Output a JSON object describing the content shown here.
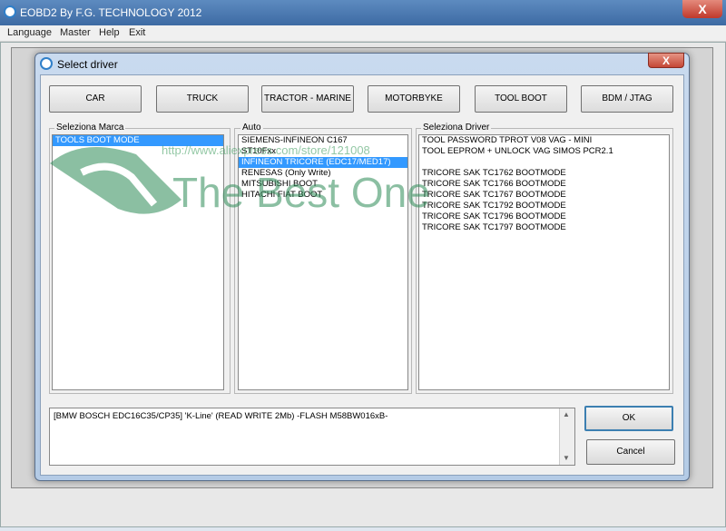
{
  "window": {
    "title": "EOBD2 By F.G. TECHNOLOGY 2012",
    "close_glyph": "X"
  },
  "menu": [
    "Language",
    "Master",
    "Help",
    "Exit"
  ],
  "dialog": {
    "title": "Select driver",
    "close_glyph": "X"
  },
  "categories": [
    "CAR",
    "TRUCK",
    "TRACTOR - MARINE",
    "MOTORBYKE",
    "TOOL BOOT",
    "BDM / JTAG"
  ],
  "marca": {
    "legend": "Seleziona Marca",
    "items": [
      "TOOLS BOOT MODE"
    ],
    "selected_index": 0
  },
  "auto": {
    "legend": "Auto",
    "items": [
      "SIEMENS-INFINEON C167",
      "ST10Fxx",
      "INFINEON TRICORE (EDC17/MED17)",
      "RENESAS (Only Write)",
      "MITSUBISHI BOOT",
      "HITACHI FIAT BOOT"
    ],
    "selected_index": 2
  },
  "driver": {
    "legend": "Seleziona Driver",
    "items": [
      "TOOL PASSWORD TPROT V08 VAG - MINI",
      "TOOL EEPROM + UNLOCK VAG SIMOS PCR2.1",
      "",
      "TRICORE SAK TC1762  BOOTMODE",
      "TRICORE SAK TC1766  BOOTMODE",
      "TRICORE SAK TC1767  BOOTMODE",
      "TRICORE SAK TC1792  BOOTMODE",
      "TRICORE SAK TC1796  BOOTMODE",
      "TRICORE SAK TC1797  BOOTMODE"
    ]
  },
  "memo": {
    "text": "[BMW BOSCH EDC16C35/CP35] 'K-Line'  (READ WRITE 2Mb)   -FLASH M58BW016xB-"
  },
  "buttons": {
    "ok": "OK",
    "cancel": "Cancel"
  },
  "watermark": {
    "text": "The Best One",
    "url": "http://www.aliexpress.com/store/121008"
  },
  "colors": {
    "selection": "#3399ff",
    "titlebar": "#4a78b0"
  }
}
